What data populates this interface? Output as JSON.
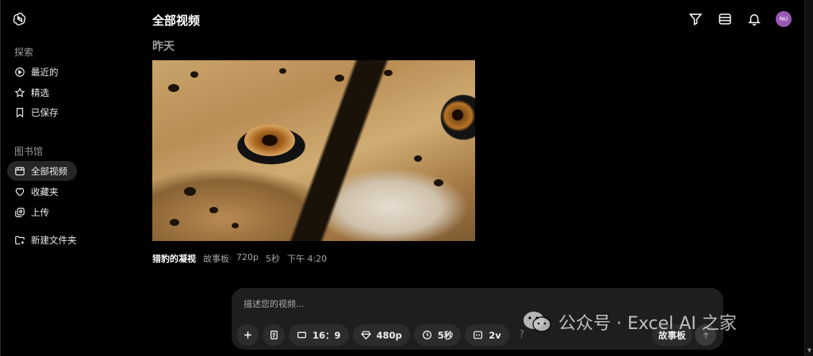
{
  "sidebar": {
    "explore_label": "探索",
    "explore_items": [
      {
        "label": "最近的",
        "icon": "play-circle-icon"
      },
      {
        "label": "精选",
        "icon": "star-icon"
      },
      {
        "label": "已保存",
        "icon": "bookmark-icon"
      }
    ],
    "library_label": "图书馆",
    "library_items": [
      {
        "label": "全部视频",
        "icon": "video-library-icon",
        "active": true
      },
      {
        "label": "收藏夹",
        "icon": "heart-icon"
      },
      {
        "label": "上传",
        "icon": "upload-icon"
      }
    ],
    "new_folder_label": "新建文件夹"
  },
  "header": {
    "title": "全部视频",
    "avatar_initials": "NU",
    "avatar_color": "#9b59b6"
  },
  "main": {
    "group_label": "昨天",
    "video": {
      "title": "猎豹的凝视",
      "type": "故事板",
      "resolution": "720p",
      "duration": "5秒",
      "time": "下午 4:20"
    }
  },
  "prompt": {
    "placeholder": "描述您的视频...",
    "aspect_ratio": "16：9",
    "resolution": "480p",
    "duration": "5秒",
    "variations": "2v",
    "help": "?",
    "storyboard_label": "故事板"
  },
  "watermark": {
    "text": "公众号 · Excel AI 之家"
  }
}
